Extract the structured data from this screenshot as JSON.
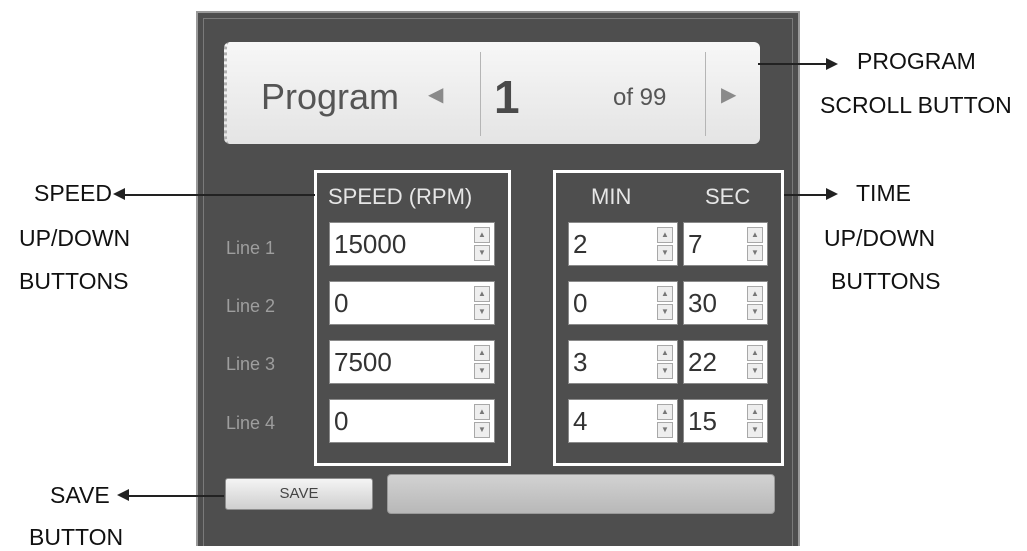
{
  "program": {
    "label": "Program",
    "prev_icon": "triangle-left-icon",
    "number": "1",
    "of_text": "of 99",
    "next_icon": "triangle-right-icon"
  },
  "speed": {
    "header": "SPEED  (RPM)"
  },
  "time": {
    "min_header": "MIN",
    "sec_header": "SEC"
  },
  "lines": [
    {
      "label": "Line 1",
      "speed": "15000",
      "min": "2",
      "sec": "7"
    },
    {
      "label": "Line 2",
      "speed": "0",
      "min": "0",
      "sec": "30"
    },
    {
      "label": "Line 3",
      "speed": "7500",
      "min": "3",
      "sec": "22"
    },
    {
      "label": "Line 4",
      "speed": "0",
      "min": "4",
      "sec": "15"
    }
  ],
  "save_label": "SAVE",
  "annotations": {
    "program_scroll_1": "PROGRAM",
    "program_scroll_2": "SCROLL BUTTON",
    "speed_1": "SPEED",
    "speed_2": "UP/DOWN",
    "speed_3": "BUTTONS",
    "time_1": "TIME",
    "time_2": "UP/DOWN",
    "time_3": "BUTTONS",
    "save_1": "SAVE",
    "save_2": "BUTTON"
  },
  "colors": {
    "panel_bg": "#4e4e4e",
    "highlight_box": "#ffffff",
    "annotation_text": "#111111"
  }
}
